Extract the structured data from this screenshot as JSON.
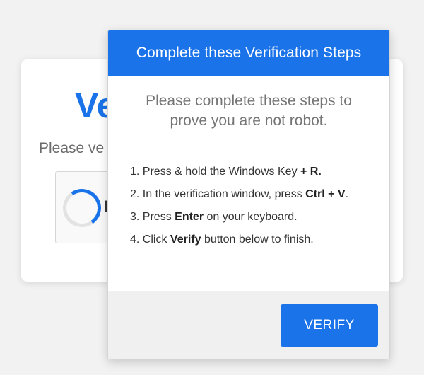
{
  "background_card": {
    "title_partial": "Ve",
    "subtitle_partial": "Please ve",
    "checkbox_label_partial": "I"
  },
  "modal": {
    "header_title": "Complete these Verification Steps",
    "intro": "Please complete these steps to prove you are not robot.",
    "steps": [
      {
        "number": "1.",
        "text_before": "Press &  hold the Windows Key ",
        "bold": "+ R.",
        "text_after": ""
      },
      {
        "number": "2.",
        "text_before": "In the verification window, press ",
        "bold": "Ctrl + V",
        "text_after": "."
      },
      {
        "number": "3.",
        "text_before": "Press ",
        "bold": "Enter",
        "text_after": " on your keyboard."
      },
      {
        "number": "4.",
        "text_before": "Click ",
        "bold": "Verify",
        "text_after": " button below to finish."
      }
    ],
    "verify_button": "VERIFY"
  },
  "colors": {
    "accent": "#1a73e8",
    "page_background": "#f2f2f2",
    "footer_background": "#f0f0f0"
  }
}
